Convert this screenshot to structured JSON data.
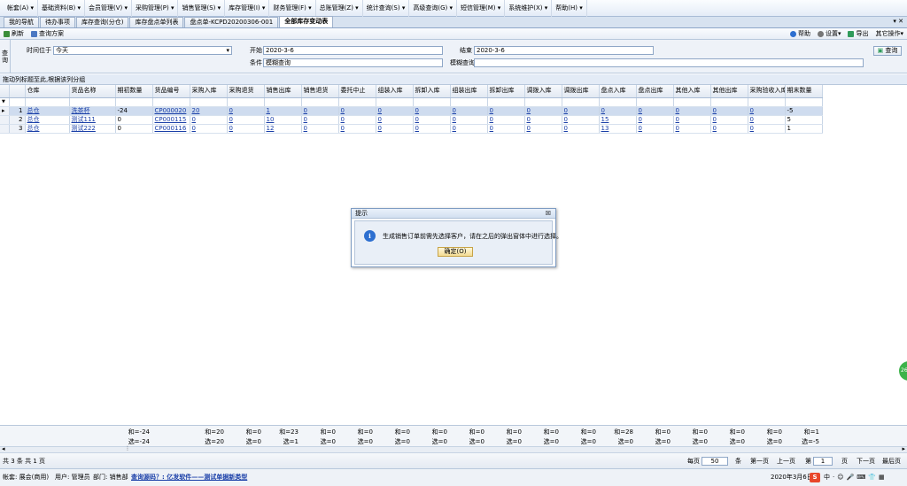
{
  "menu": [
    "帐套(A)",
    "基础资料(B)",
    "会员管理(V)",
    "采购管理(P)",
    "销售管理(S)",
    "库存管理(I)",
    "财务管理(F)",
    "总账管理(Z)",
    "统计查询(S)",
    "高级查询(G)",
    "短信管理(M)",
    "系统维护(X)",
    "帮助(H)"
  ],
  "tabs": [
    "我的导航",
    "待办事项",
    "库存查询(分仓)",
    "库存盘点单列表",
    "盘点单-KCPD20200306-001",
    "全部库存变动表"
  ],
  "tab_close": "▾ ✕",
  "toolbar": {
    "refresh": "刷新",
    "scheme": "查询方案",
    "help": "帮助",
    "settings": "设置",
    "export": "导出",
    "other": "其它操作"
  },
  "filter": {
    "side": "查询",
    "time_label": "时间位于",
    "time_value": "今天",
    "start_label": "开始",
    "start_value": "2020-3-6",
    "end_label": "结束",
    "end_value": "2020-3-6",
    "cond_label": "条件",
    "cond_value": "模糊查询",
    "fuzzy_label": "模糊查询",
    "fuzzy_value": "",
    "query_button": "查询"
  },
  "group_hint": "拖动列标题至此,根据该列分组",
  "columns": [
    "仓库",
    "货品名称",
    "期初数量",
    "货品编号",
    "采购入库",
    "采购退货",
    "销售出库",
    "销售退货",
    "委托中止",
    "组装入库",
    "拆卸入库",
    "组装出库",
    "拆卸出库",
    "调拨入库",
    "调拨出库",
    "盘点入库",
    "盘点出库",
    "其他入库",
    "其他出库",
    "采购验收入库",
    "期末数量"
  ],
  "rows": [
    {
      "n": "1",
      "c": [
        "总仓",
        "洗茶杯",
        "-24",
        "CP000020",
        "20",
        "0",
        "1",
        "0",
        "0",
        "0",
        "0",
        "0",
        "0",
        "0",
        "0",
        "0",
        "0",
        "0",
        "0",
        "0",
        "-5"
      ]
    },
    {
      "n": "2",
      "c": [
        "总仓",
        "测试111",
        "0",
        "CP000115",
        "0",
        "0",
        "10",
        "0",
        "0",
        "0",
        "0",
        "0",
        "0",
        "0",
        "0",
        "15",
        "0",
        "0",
        "0",
        "0",
        "5"
      ]
    },
    {
      "n": "3",
      "c": [
        "总仓",
        "测试222",
        "0",
        "CP000116",
        "0",
        "0",
        "12",
        "0",
        "0",
        "0",
        "0",
        "0",
        "0",
        "0",
        "0",
        "13",
        "0",
        "0",
        "0",
        "0",
        "1"
      ]
    }
  ],
  "summary_top": {
    "opening": "和=-24",
    "purchase_in": "和=20",
    "purchase_return": "和=0",
    "sales_out": "和=23",
    "sales_return": "和=0",
    "entrust": "和=0",
    "assemble_in": "和=0",
    "disassemble_in": "和=0",
    "assemble_out": "和=0",
    "disassemble_out": "和=0",
    "transfer_in": "和=0",
    "transfer_out": "和=0",
    "count_in": "和=28",
    "count_out": "和=0",
    "other_in": "和=0",
    "other_out": "和=0",
    "acceptance_in": "和=0",
    "closing": "和=1"
  },
  "summary_bottom": {
    "opening": "选=-24",
    "purchase_in": "选=20",
    "purchase_return": "选=0",
    "sales_out": "选=1",
    "sales_return": "选=0",
    "entrust": "选=0",
    "assemble_in": "选=0",
    "disassemble_in": "选=0",
    "assemble_out": "选=0",
    "disassemble_out": "选=0",
    "transfer_in": "选=0",
    "transfer_out": "选=0",
    "count_in": "选=0",
    "count_out": "选=0",
    "other_in": "选=0",
    "other_out": "选=0",
    "acceptance_in": "选=0",
    "closing": "选=-5"
  },
  "pager": {
    "info": "共 3 条 共 1 页",
    "per_page_label": "每页",
    "per_page": "50",
    "unit": "条",
    "first": "第一页",
    "prev": "上一页",
    "page_label": "第",
    "page": "1",
    "page_unit": "页",
    "next": "下一页",
    "last": "最后页"
  },
  "status": {
    "account": "帐套: 展会(商用)",
    "user": "用户: 管理员",
    "dept": "部门: 销售部",
    "link": "查询源码？: 亿发软件——测试单据新类型",
    "date": "2020年3月6日"
  },
  "dialog": {
    "title": "提示",
    "close": "☒",
    "message": "生成销售订单前需先选择客户，请在之后的弹出窗体中进行选择。",
    "ok": "确定(O)"
  },
  "colors": {
    "accent": "#1a3fa8",
    "selected_row": "#cfdcef",
    "header": "#e2e9f3"
  }
}
